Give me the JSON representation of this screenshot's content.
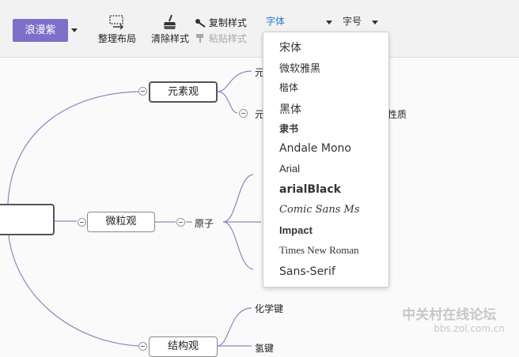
{
  "toolbar": {
    "theme_label": "浪漫紫",
    "arrange_label": "整理布局",
    "clear_style_label": "清除样式",
    "copy_style_label": "复制样式",
    "paste_style_label": "粘贴样式",
    "font_label": "字体",
    "font_size_label": "字号"
  },
  "mindmap": {
    "node_yuansu": "元素观",
    "node_weili": "微粒观",
    "node_jiegou": "结构观",
    "branch_yuan_1": "元",
    "branch_yuan_2": "元",
    "branch_xingzhi": "性质",
    "branch_yuanzi": "原子",
    "branch_huaxuejian": "化学键",
    "branch_qingjian": "氢键"
  },
  "font_menu": {
    "options": [
      "宋体",
      "微软雅黑",
      "楷体",
      "黑体",
      "隶书",
      "Andale Mono",
      "Arial",
      "arialBlack",
      "Comic Sans Ms",
      "Impact",
      "Times New Roman",
      "Sans-Serif"
    ]
  },
  "watermark": {
    "title": "中关村在线论坛",
    "url": "bbs.zol.com.cn"
  },
  "colors": {
    "accent": "#7f6fc8",
    "link_blue": "#2b7cd3"
  }
}
